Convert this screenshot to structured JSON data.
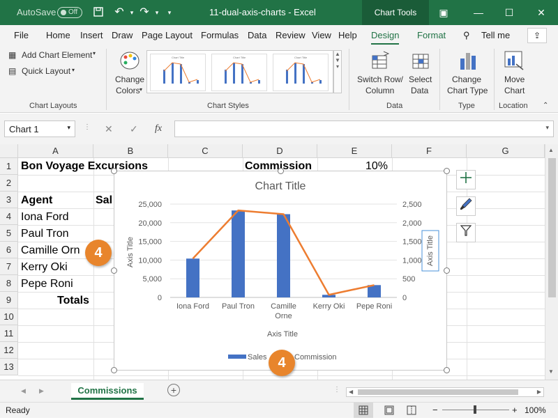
{
  "titlebar": {
    "autosave_label": "AutoSave",
    "autosave_state": "Off",
    "document_title": "11-dual-axis-charts  -  Excel",
    "context_tab": "Chart Tools"
  },
  "menu": [
    "File",
    "Home",
    "Insert",
    "Draw",
    "Page Layout",
    "Formulas",
    "Data",
    "Review",
    "View",
    "Help",
    "Design",
    "Format"
  ],
  "tell_me": "Tell me",
  "ribbon": {
    "add_chart_element": "Add Chart Element",
    "quick_layout": "Quick Layout",
    "change_colors_1": "Change",
    "change_colors_2": "Colors",
    "switch_row_1": "Switch Row/",
    "switch_row_2": "Column",
    "select_data_1": "Select",
    "select_data_2": "Data",
    "change_type_1": "Change",
    "change_type_2": "Chart Type",
    "move_chart_1": "Move",
    "move_chart_2": "Chart",
    "groups": {
      "layouts": "Chart Layouts",
      "styles": "Chart Styles",
      "data": "Data",
      "type": "Type",
      "location": "Location"
    }
  },
  "formula_bar": {
    "name_box": "Chart 1",
    "fx": "fx"
  },
  "columns": [
    "A",
    "B",
    "C",
    "D",
    "E",
    "F",
    "G"
  ],
  "rows": [
    "1",
    "2",
    "3",
    "4",
    "5",
    "6",
    "7",
    "8",
    "9",
    "10",
    "11",
    "12",
    "13"
  ],
  "cells": {
    "a1": "Bon Voyage Excursions",
    "d1": "Commission",
    "e1": "10%",
    "a3": "Agent",
    "b3": "Sal",
    "a4": "Iona Ford",
    "a5": "Paul Tron",
    "a6": "Camille  Orn",
    "a7": "Kerry Oki",
    "a8": "Pepe Roni",
    "a9": "Totals"
  },
  "chart_data": {
    "type": "bar",
    "title": "Chart Title",
    "xlabel": "Axis Title",
    "ylabel": "Axis Title",
    "y2label": "Axis Title",
    "categories": [
      "Iona Ford",
      "Paul Tron",
      "Camille Orne",
      "Kerry Oki",
      "Pepe Roni"
    ],
    "series": [
      {
        "name": "Sales",
        "type": "bar",
        "axis": "left",
        "color": "#4472c4",
        "values": [
          10400,
          23300,
          22300,
          700,
          3300
        ]
      },
      {
        "name": "Commission",
        "type": "line",
        "axis": "right",
        "color": "#ed7d31",
        "values": [
          1040,
          2330,
          2230,
          70,
          330
        ]
      }
    ],
    "ylim": [
      0,
      25000
    ],
    "yticks": [
      "0",
      "5,000",
      "10,000",
      "15,000",
      "20,000",
      "25,000"
    ],
    "y2lim": [
      0,
      2500
    ],
    "y2ticks": [
      "0",
      "500",
      "1,000",
      "1,500",
      "2,000",
      "2,500"
    ],
    "legend": "bottom",
    "grid": true
  },
  "callouts": [
    "4",
    "4"
  ],
  "sheet_tab": "Commissions",
  "status": {
    "ready": "Ready",
    "zoom": "100%"
  },
  "colors": {
    "excel_green": "#217346",
    "accent_orange": "#e8852c"
  }
}
